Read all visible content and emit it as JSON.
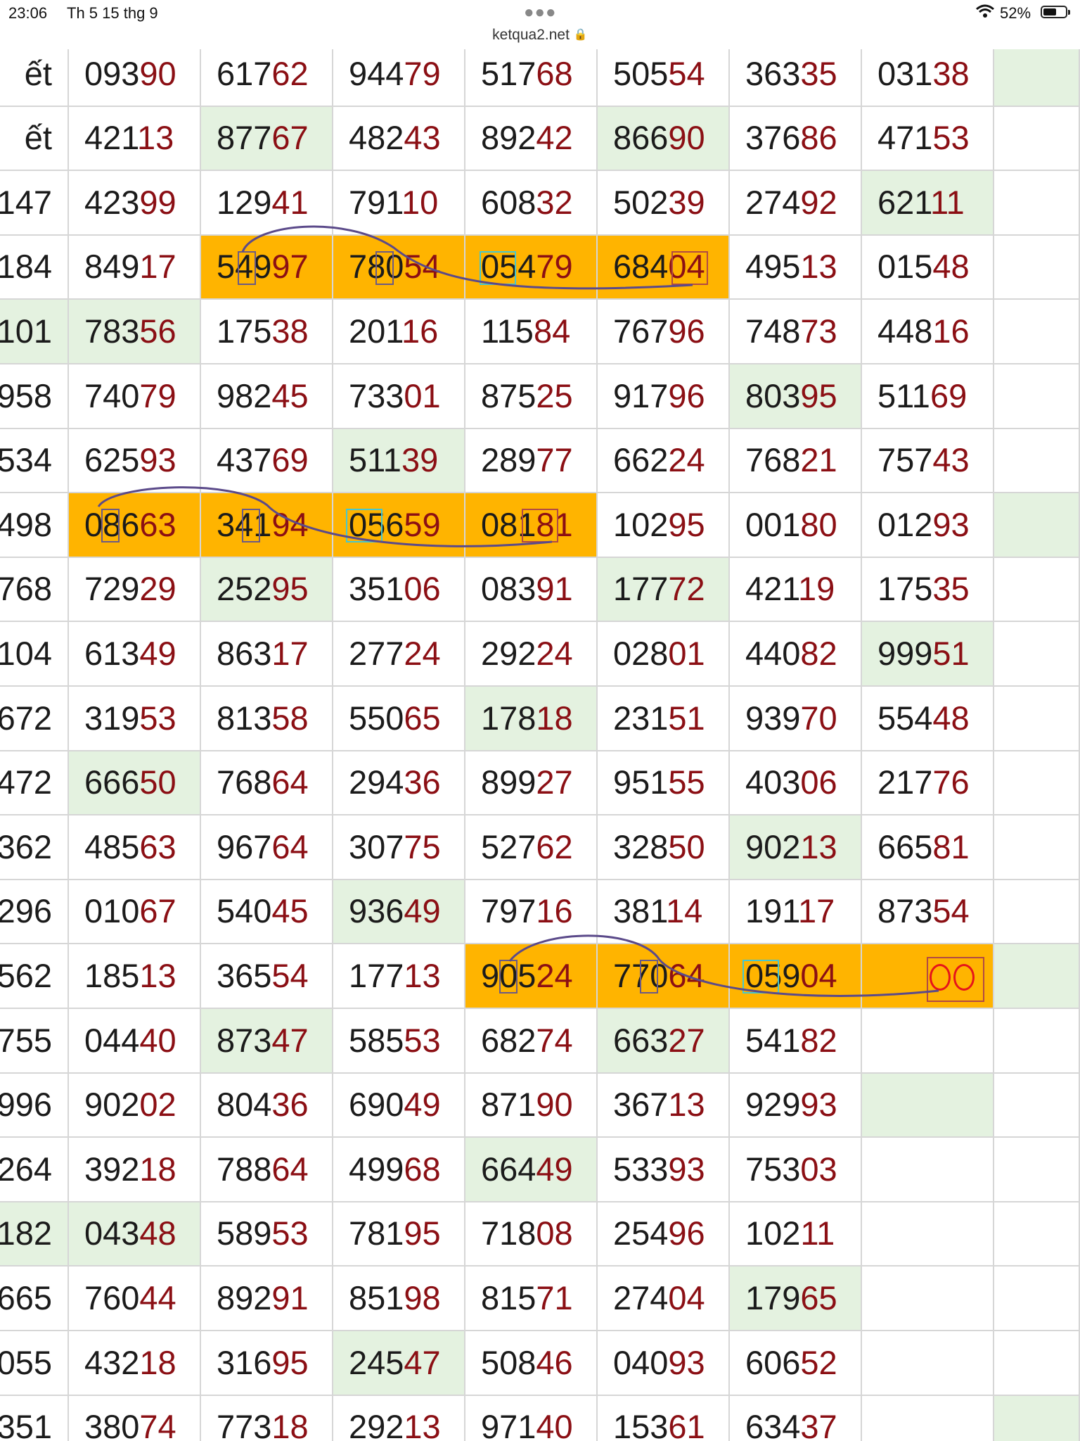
{
  "status_bar": {
    "time": "23:06",
    "date": "Th 5 15 thg 9",
    "battery": "52%",
    "icons": [
      "wifi-icon",
      "battery-icon",
      "more-dots-icon"
    ]
  },
  "url_bar": {
    "domain": "ketqua2.net",
    "icon": "lock-icon"
  },
  "colors": {
    "tail_digits": "#8b0f14",
    "highlight_green": "#e4f2e0",
    "highlight_orange": "#ffb400",
    "circle_red": "#e6141a",
    "pen_purple": "#5b4a8a"
  },
  "table": {
    "rows": [
      {
        "partial": "ết",
        "cells": [
          "09390",
          "61762",
          "94479",
          "51768",
          "50554",
          "36335",
          "03138",
          ""
        ]
      },
      {
        "partial": "ết",
        "cells": [
          "42113",
          "87767",
          "48243",
          "89242",
          "86690",
          "37686",
          "47153",
          ""
        ]
      },
      {
        "partial": "147",
        "cells": [
          "42399",
          "12941",
          "79110",
          "60832",
          "50239",
          "27492",
          "62111",
          ""
        ]
      },
      {
        "partial": "184",
        "cells": [
          "84917",
          "54997",
          "78054",
          "05479",
          "68404",
          "49513",
          "01548",
          ""
        ]
      },
      {
        "partial": "101",
        "cells": [
          "78356",
          "17538",
          "20116",
          "11584",
          "76796",
          "74873",
          "44816",
          ""
        ]
      },
      {
        "partial": "958",
        "cells": [
          "74079",
          "98245",
          "73301",
          "87525",
          "91796",
          "80395",
          "51169",
          ""
        ]
      },
      {
        "partial": "534",
        "cells": [
          "62593",
          "43769",
          "51139",
          "28977",
          "66224",
          "76821",
          "75743",
          ""
        ]
      },
      {
        "partial": "498",
        "cells": [
          "08663",
          "34194",
          "05659",
          "08181",
          "10295",
          "00180",
          "01293",
          ""
        ]
      },
      {
        "partial": "768",
        "cells": [
          "72929",
          "25295",
          "35106",
          "08391",
          "17772",
          "42119",
          "17535",
          ""
        ]
      },
      {
        "partial": "104",
        "cells": [
          "61349",
          "86317",
          "27724",
          "29224",
          "02801",
          "44082",
          "99951",
          ""
        ]
      },
      {
        "partial": "672",
        "cells": [
          "31953",
          "81358",
          "55065",
          "17818",
          "23151",
          "93970",
          "55448",
          ""
        ]
      },
      {
        "partial": "472",
        "cells": [
          "66650",
          "76864",
          "29436",
          "89927",
          "95155",
          "40306",
          "21776",
          ""
        ]
      },
      {
        "partial": "362",
        "cells": [
          "48563",
          "96764",
          "30775",
          "52762",
          "32850",
          "90213",
          "66581",
          ""
        ]
      },
      {
        "partial": "296",
        "cells": [
          "01067",
          "54045",
          "93649",
          "79716",
          "38114",
          "19117",
          "87354",
          ""
        ]
      },
      {
        "partial": "562",
        "cells": [
          "18513",
          "36554",
          "17713",
          "90524",
          "77064",
          "05904",
          "",
          ""
        ]
      },
      {
        "partial": "755",
        "cells": [
          "04440",
          "87347",
          "58553",
          "68274",
          "66327",
          "54182",
          "",
          ""
        ]
      },
      {
        "partial": "996",
        "cells": [
          "90202",
          "80436",
          "69049",
          "87190",
          "36713",
          "92993",
          "",
          ""
        ]
      },
      {
        "partial": "264",
        "cells": [
          "39218",
          "78864",
          "49968",
          "66449",
          "53393",
          "75303",
          "",
          ""
        ]
      },
      {
        "partial": "182",
        "cells": [
          "04348",
          "58953",
          "78195",
          "71808",
          "25496",
          "10211",
          "",
          ""
        ]
      },
      {
        "partial": "665",
        "cells": [
          "76044",
          "89291",
          "85198",
          "81571",
          "27404",
          "17965",
          "",
          ""
        ]
      },
      {
        "partial": "055",
        "cells": [
          "43218",
          "31695",
          "24547",
          "50846",
          "04093",
          "60652",
          "",
          ""
        ]
      },
      {
        "partial": "351",
        "cells": [
          "38074",
          "77318",
          "29213",
          "97140",
          "15361",
          "63437",
          "",
          ""
        ]
      }
    ],
    "green_cells": [
      [
        0,
        8
      ],
      [
        1,
        2
      ],
      [
        1,
        5
      ],
      [
        2,
        7
      ],
      [
        4,
        0
      ],
      [
        4,
        1
      ],
      [
        5,
        6
      ],
      [
        6,
        3
      ],
      [
        7,
        8
      ],
      [
        8,
        2
      ],
      [
        8,
        5
      ],
      [
        9,
        7
      ],
      [
        10,
        4
      ],
      [
        11,
        1
      ],
      [
        12,
        6
      ],
      [
        13,
        3
      ],
      [
        14,
        8
      ],
      [
        15,
        2
      ],
      [
        15,
        5
      ],
      [
        16,
        7
      ],
      [
        17,
        4
      ],
      [
        18,
        0
      ],
      [
        18,
        1
      ],
      [
        19,
        6
      ],
      [
        20,
        3
      ],
      [
        21,
        8
      ]
    ],
    "orange_cells": [
      [
        3,
        2
      ],
      [
        3,
        3
      ],
      [
        3,
        4
      ],
      [
        3,
        5
      ],
      [
        7,
        1
      ],
      [
        7,
        2
      ],
      [
        7,
        3
      ],
      [
        7,
        4
      ],
      [
        14,
        4
      ],
      [
        14,
        5
      ],
      [
        14,
        6
      ],
      [
        14,
        7
      ]
    ],
    "circled_prediction": "00"
  }
}
